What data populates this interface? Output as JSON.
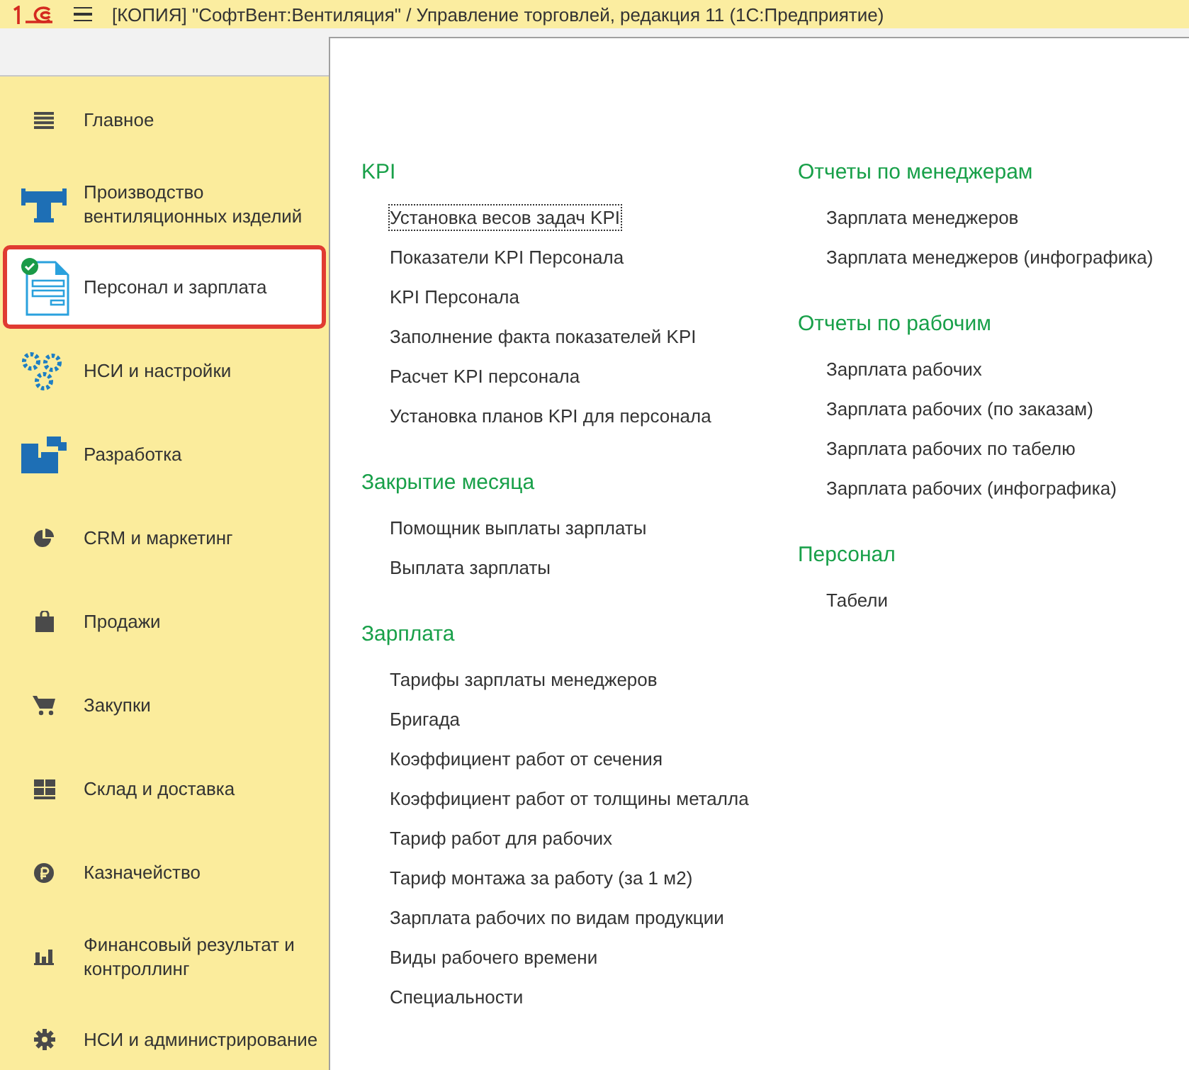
{
  "window": {
    "title": "[КОПИЯ] \"СофтВент:Вентиляция\" / Управление торговлей, редакция 11  (1С:Предприятие)"
  },
  "sidebar": {
    "items": [
      {
        "label": "Главное",
        "selected": false
      },
      {
        "label": "Производство вентиляционных изделий",
        "selected": false
      },
      {
        "label": "Персонал и зарплата",
        "selected": true
      },
      {
        "label": "НСИ и настройки",
        "selected": false
      },
      {
        "label": "Разработка",
        "selected": false
      },
      {
        "label": "CRM и маркетинг",
        "selected": false
      },
      {
        "label": "Продажи",
        "selected": false
      },
      {
        "label": "Закупки",
        "selected": false
      },
      {
        "label": "Склад и доставка",
        "selected": false
      },
      {
        "label": "Казначейство",
        "selected": false
      },
      {
        "label": "Финансовый результат и контроллинг",
        "selected": false
      },
      {
        "label": "НСИ и администрирование",
        "selected": false
      }
    ]
  },
  "columns": [
    {
      "sections": [
        {
          "title": "KPI",
          "links": [
            {
              "label": "Установка весов задач KPI",
              "focused": true
            },
            {
              "label": "Показатели KPI Персонала",
              "focused": false
            },
            {
              "label": "KPI Персонала",
              "focused": false
            },
            {
              "label": "Заполнение факта показателей KPI",
              "focused": false
            },
            {
              "label": "Расчет KPI персонала",
              "focused": false
            },
            {
              "label": "Установка планов KPI для персонала",
              "focused": false
            }
          ]
        },
        {
          "title": "Закрытие месяца",
          "links": [
            {
              "label": "Помощник выплаты зарплаты",
              "focused": false
            },
            {
              "label": "Выплата зарплаты",
              "focused": false
            }
          ]
        },
        {
          "title": "Зарплата",
          "links": [
            {
              "label": "Тарифы зарплаты менеджеров",
              "focused": false
            },
            {
              "label": "Бригада",
              "focused": false
            },
            {
              "label": "Коэффициент работ от сечения",
              "focused": false
            },
            {
              "label": "Коэффициент работ от толщины металла",
              "focused": false
            },
            {
              "label": "Тариф работ для рабочих",
              "focused": false
            },
            {
              "label": "Тариф монтажа за работу (за 1 м2)",
              "focused": false
            },
            {
              "label": "Зарплата рабочих по видам продукции",
              "focused": false
            },
            {
              "label": "Виды рабочего времени",
              "focused": false
            },
            {
              "label": "Специальности",
              "focused": false
            }
          ]
        }
      ]
    },
    {
      "sections": [
        {
          "title": "Отчеты по менеджерам",
          "links": [
            {
              "label": "Зарплата менеджеров",
              "focused": false
            },
            {
              "label": "Зарплата менеджеров (инфографика)",
              "focused": false
            }
          ]
        },
        {
          "title": "Отчеты по рабочим",
          "links": [
            {
              "label": "Зарплата рабочих",
              "focused": false
            },
            {
              "label": "Зарплата рабочих (по заказам)",
              "focused": false
            },
            {
              "label": "Зарплата рабочих по табелю",
              "focused": false
            },
            {
              "label": "Зарплата рабочих (инфографика)",
              "focused": false
            }
          ]
        },
        {
          "title": "Персонал",
          "links": [
            {
              "label": "Табели",
              "focused": false
            }
          ]
        }
      ]
    }
  ]
}
